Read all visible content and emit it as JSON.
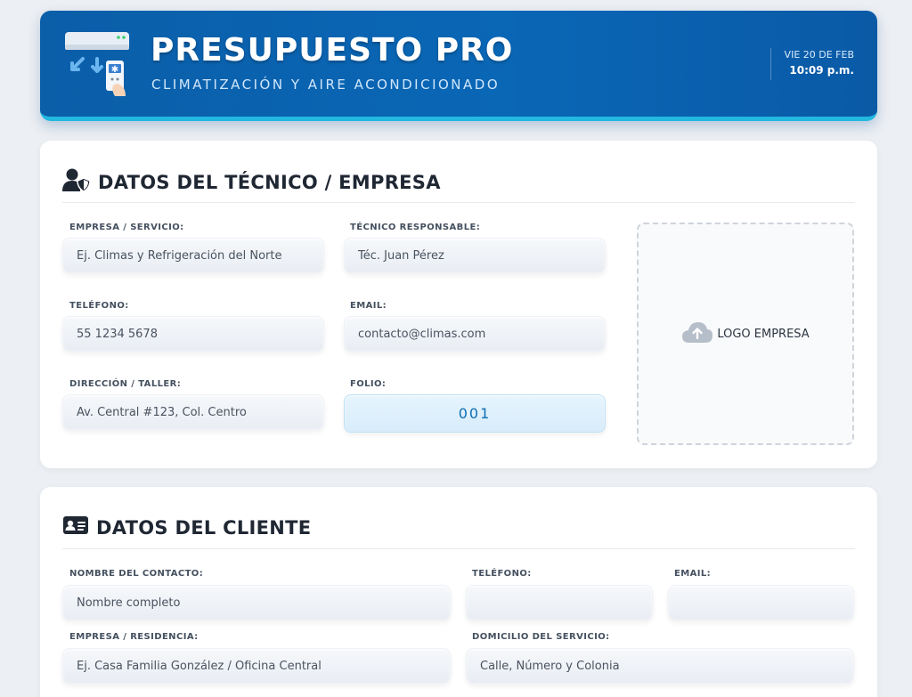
{
  "header": {
    "title": "PRESUPUESTO PRO",
    "subtitle": "CLIMATIZACIÓN Y AIRE ACONDICIONADO",
    "date": "VIE 20 DE FEB",
    "time": "10:09 p.m."
  },
  "tecnico": {
    "section_title": "DATOS DEL TÉCNICO / EMPRESA",
    "empresa_label": "EMPRESA / SERVICIO:",
    "empresa_placeholder": "Ej. Climas y Refrigeración del Norte",
    "tecnico_label": "TÉCNICO RESPONSABLE:",
    "tecnico_placeholder": "Téc. Juan Pérez",
    "telefono_label": "TELÉFONO:",
    "telefono_placeholder": "55 1234 5678",
    "email_label": "EMAIL:",
    "email_placeholder": "contacto@climas.com",
    "direccion_label": "DIRECCIÓN / TALLER:",
    "direccion_placeholder": "Av. Central #123, Col. Centro",
    "folio_label": "FOLIO:",
    "folio_value": "001",
    "logo_label": "LOGO EMPRESA"
  },
  "cliente": {
    "section_title": "DATOS DEL CLIENTE",
    "nombre_label": "NOMBRE DEL CONTACTO:",
    "nombre_placeholder": "Nombre completo",
    "telefono_label": "TELÉFONO:",
    "telefono_placeholder": "",
    "email_label": "EMAIL:",
    "email_placeholder": "",
    "empresa_label": "EMPRESA / RESIDENCIA:",
    "empresa_placeholder": "Ej. Casa Familia González / Oficina Central",
    "domicilio_label": "DOMICILIO DEL SERVICIO:",
    "domicilio_placeholder": "Calle, Número y Colonia"
  },
  "colors": {
    "header_blue": "#0a67b6",
    "header_accent": "#22b8e0",
    "folio_text": "#0b6fb3"
  }
}
